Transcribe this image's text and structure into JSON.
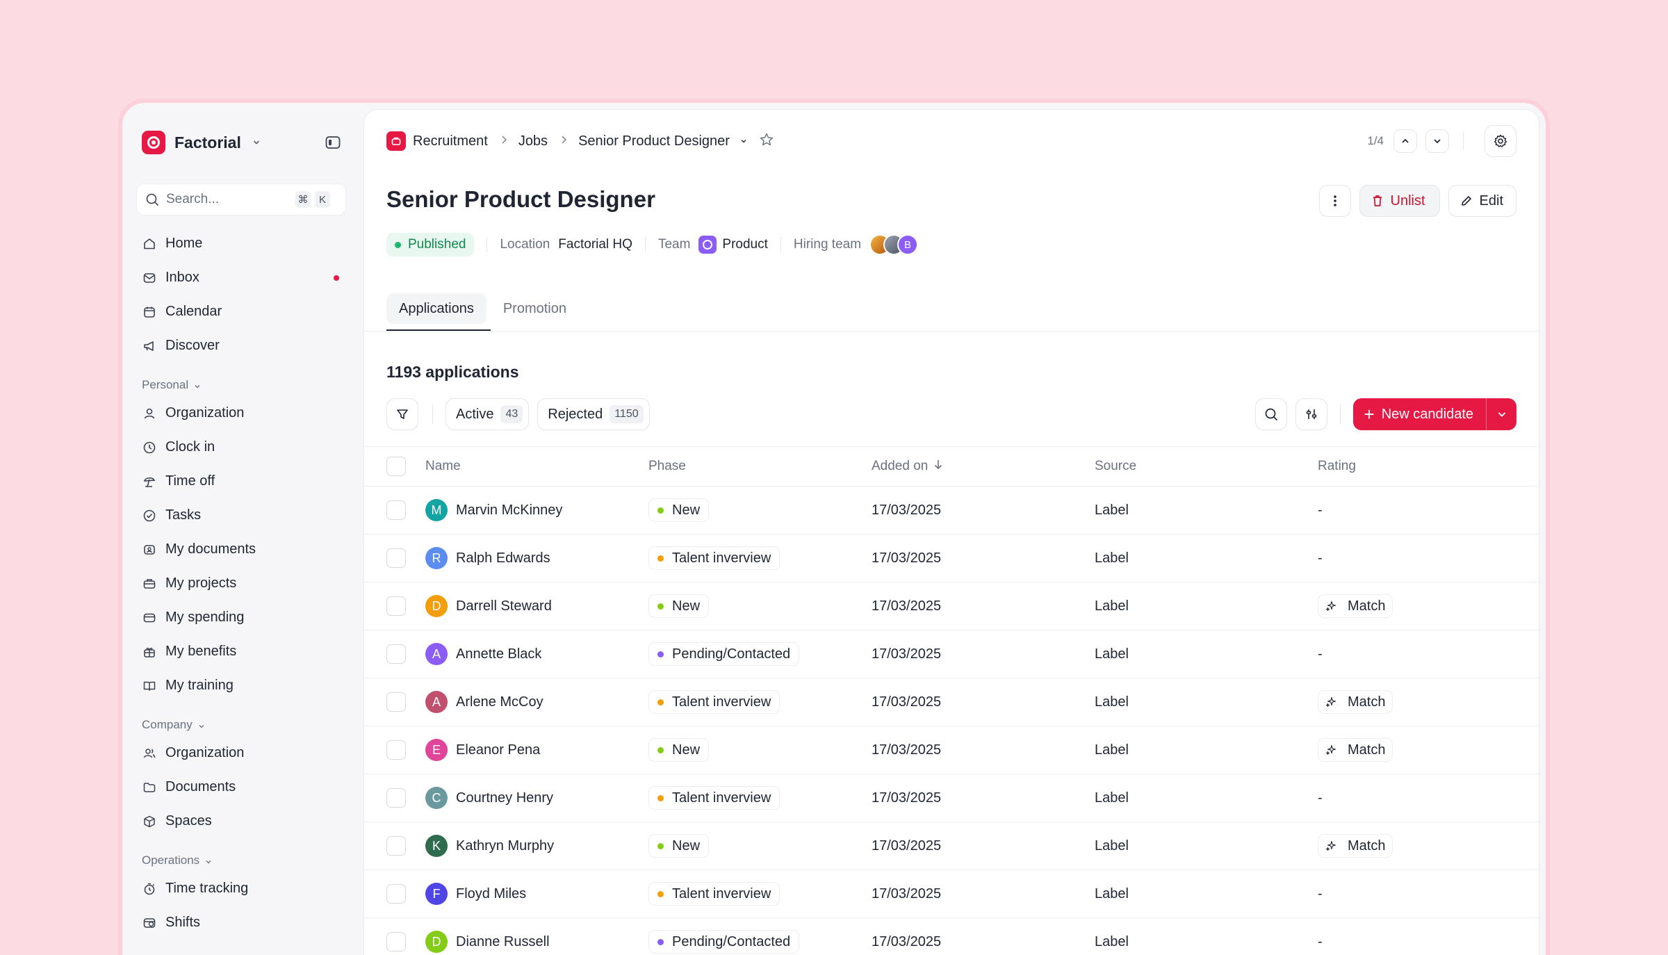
{
  "brand": {
    "name": "Factorial"
  },
  "search": {
    "placeholder": "Search...",
    "shortcut_1": "⌘",
    "shortcut_2": "K"
  },
  "sidebar": {
    "main_items": [
      {
        "label": "Home",
        "icon": "home-icon"
      },
      {
        "label": "Inbox",
        "icon": "inbox-icon",
        "unread": true
      },
      {
        "label": "Calendar",
        "icon": "calendar-icon"
      },
      {
        "label": "Discover",
        "icon": "megaphone-icon"
      }
    ],
    "personal_label": "Personal",
    "personal_items": [
      {
        "label": "Organization",
        "icon": "person-icon"
      },
      {
        "label": "Clock in",
        "icon": "clock-icon"
      },
      {
        "label": "Time off",
        "icon": "beach-icon"
      },
      {
        "label": "Tasks",
        "icon": "check-circle-icon"
      },
      {
        "label": "My documents",
        "icon": "document-icon"
      },
      {
        "label": "My projects",
        "icon": "briefcase-icon"
      },
      {
        "label": "My spending",
        "icon": "wallet-icon"
      },
      {
        "label": "My benefits",
        "icon": "gift-icon"
      },
      {
        "label": "My training",
        "icon": "book-icon"
      }
    ],
    "company_label": "Company",
    "company_items": [
      {
        "label": "Organization",
        "icon": "people-icon"
      },
      {
        "label": "Documents",
        "icon": "folder-icon"
      },
      {
        "label": "Spaces",
        "icon": "cube-icon"
      }
    ],
    "operations_label": "Operations",
    "operations_items": [
      {
        "label": "Time tracking",
        "icon": "stopwatch-icon"
      },
      {
        "label": "Shifts",
        "icon": "shifts-icon"
      }
    ]
  },
  "breadcrumb": {
    "module": "Recruitment",
    "section": "Jobs",
    "current": "Senior Product Designer"
  },
  "pager": {
    "text": "1/4"
  },
  "job": {
    "title": "Senior Product Designer",
    "status": "Published",
    "location_label": "Location",
    "location_value": "Factorial HQ",
    "team_label": "Team",
    "team_value": "Product",
    "hiring_label": "Hiring team",
    "hiring_avatar_initial": "B"
  },
  "actions": {
    "unlist": "Unlist",
    "edit": "Edit"
  },
  "tabs": [
    {
      "label": "Applications",
      "active": true
    },
    {
      "label": "Promotion",
      "active": false
    }
  ],
  "applications_count": "1193 applications",
  "filters": {
    "active_label": "Active",
    "active_count": "43",
    "rejected_label": "Rejected",
    "rejected_count": "1150"
  },
  "new_candidate_label": "New candidate",
  "colors": {
    "accent": "#e51943",
    "published": "#19b86a"
  },
  "table": {
    "columns": {
      "name": "Name",
      "phase": "Phase",
      "added": "Added on",
      "source": "Source",
      "rating": "Rating"
    },
    "rows": [
      {
        "initial": "M",
        "name": "Marvin McKinney",
        "avatar_color": "#14a3a3",
        "phase": "New",
        "phase_color": "#84cc16",
        "added": "17/03/2025",
        "source": "Label",
        "rating": "-"
      },
      {
        "initial": "R",
        "name": "Ralph Edwards",
        "avatar_color": "#5b8def",
        "phase": "Talent inverview",
        "phase_color": "#f59e0b",
        "added": "17/03/2025",
        "source": "Label",
        "rating": "-"
      },
      {
        "initial": "D",
        "name": "Darrell Steward",
        "avatar_color": "#f59e0b",
        "phase": "New",
        "phase_color": "#84cc16",
        "added": "17/03/2025",
        "source": "Label",
        "rating": "Match"
      },
      {
        "initial": "A",
        "name": "Annette Black",
        "avatar_color": "#8b5cf6",
        "phase": "Pending/Contacted",
        "phase_color": "#8b5cf6",
        "added": "17/03/2025",
        "source": "Label",
        "rating": "-"
      },
      {
        "initial": "A",
        "name": "Arlene McCoy",
        "avatar_color": "#c0506e",
        "phase": "Talent inverview",
        "phase_color": "#f59e0b",
        "added": "17/03/2025",
        "source": "Label",
        "rating": "Match"
      },
      {
        "initial": "E",
        "name": "Eleanor Pena",
        "avatar_color": "#e0459a",
        "phase": "New",
        "phase_color": "#84cc16",
        "added": "17/03/2025",
        "source": "Label",
        "rating": "Match"
      },
      {
        "initial": "C",
        "name": "Courtney Henry",
        "avatar_color": "#6b9a9e",
        "phase": "Talent inverview",
        "phase_color": "#f59e0b",
        "added": "17/03/2025",
        "source": "Label",
        "rating": "-"
      },
      {
        "initial": "K",
        "name": "Kathryn Murphy",
        "avatar_color": "#2f6b4f",
        "phase": "New",
        "phase_color": "#84cc16",
        "added": "17/03/2025",
        "source": "Label",
        "rating": "Match"
      },
      {
        "initial": "F",
        "name": "Floyd Miles",
        "avatar_color": "#4f46e5",
        "phase": "Talent inverview",
        "phase_color": "#f59e0b",
        "added": "17/03/2025",
        "source": "Label",
        "rating": "-"
      },
      {
        "initial": "D",
        "name": "Dianne Russell",
        "avatar_color": "#84cc16",
        "phase": "Pending/Contacted",
        "phase_color": "#8b5cf6",
        "added": "17/03/2025",
        "source": "Label",
        "rating": "-"
      }
    ]
  }
}
